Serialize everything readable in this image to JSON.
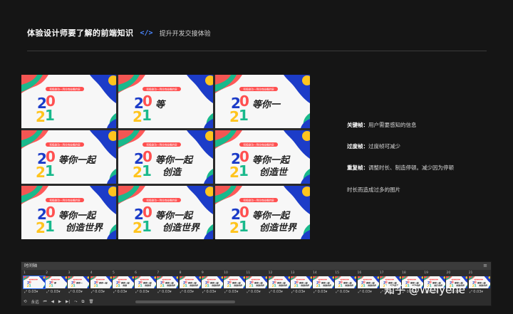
{
  "header": {
    "title": "体验设计师要了解的前端知识",
    "code_tag": "</>",
    "subtitle": "提升开发交接体验"
  },
  "colors": {
    "blue": "#1c3cc8",
    "red": "#ff5050",
    "green": "#19b98c",
    "yellow": "#ffc41e",
    "accent": "#2d6cf0"
  },
  "poster": {
    "banner": "积极励动—用住有技概的层",
    "year_top": "20",
    "year_bottom": "21",
    "line1": "等你一起",
    "line2": "创造世界"
  },
  "frames": [
    {
      "label": "frame-1",
      "line1": "",
      "line2": ""
    },
    {
      "label": "frame-2",
      "line1": "等",
      "line2": ""
    },
    {
      "label": "frame-3",
      "line1": "等你一",
      "line2": ""
    },
    {
      "label": "frame-4",
      "line1": "等你一起",
      "line2": ""
    },
    {
      "label": "frame-5",
      "line1": "等你一起",
      "line2": "创造"
    },
    {
      "label": "frame-6",
      "line1": "等你一起",
      "line2": "创造世"
    },
    {
      "label": "frame-7",
      "line1": "等你一起",
      "line2": "创造世界"
    },
    {
      "label": "frame-8",
      "line1": "等你一起",
      "line2": "创造世界"
    },
    {
      "label": "frame-9",
      "line1": "等你一起",
      "line2": "创造世界"
    }
  ],
  "notes": [
    {
      "term": "关键帧：",
      "text": "用户需要感知的信息"
    },
    {
      "term": "过度帧：",
      "text": "过度帧可减少"
    },
    {
      "term": "重复帧：",
      "text": "调整时长、制造停顿。减少因为停顿"
    },
    {
      "term": "",
      "text": "时长而造成过多的图片"
    }
  ],
  "timeline": {
    "title": "时间轴",
    "menu": "≡",
    "frame_numbers": [
      "1",
      "2",
      "3",
      "4",
      "5",
      "6",
      "7",
      "8",
      "9",
      "10",
      "11",
      "12",
      "13",
      "14",
      "15",
      "16",
      "17",
      "18",
      "19",
      "20",
      "21"
    ],
    "duration": "0.03",
    "loop": "永远",
    "watermark": "知乎 @Weiyene"
  }
}
